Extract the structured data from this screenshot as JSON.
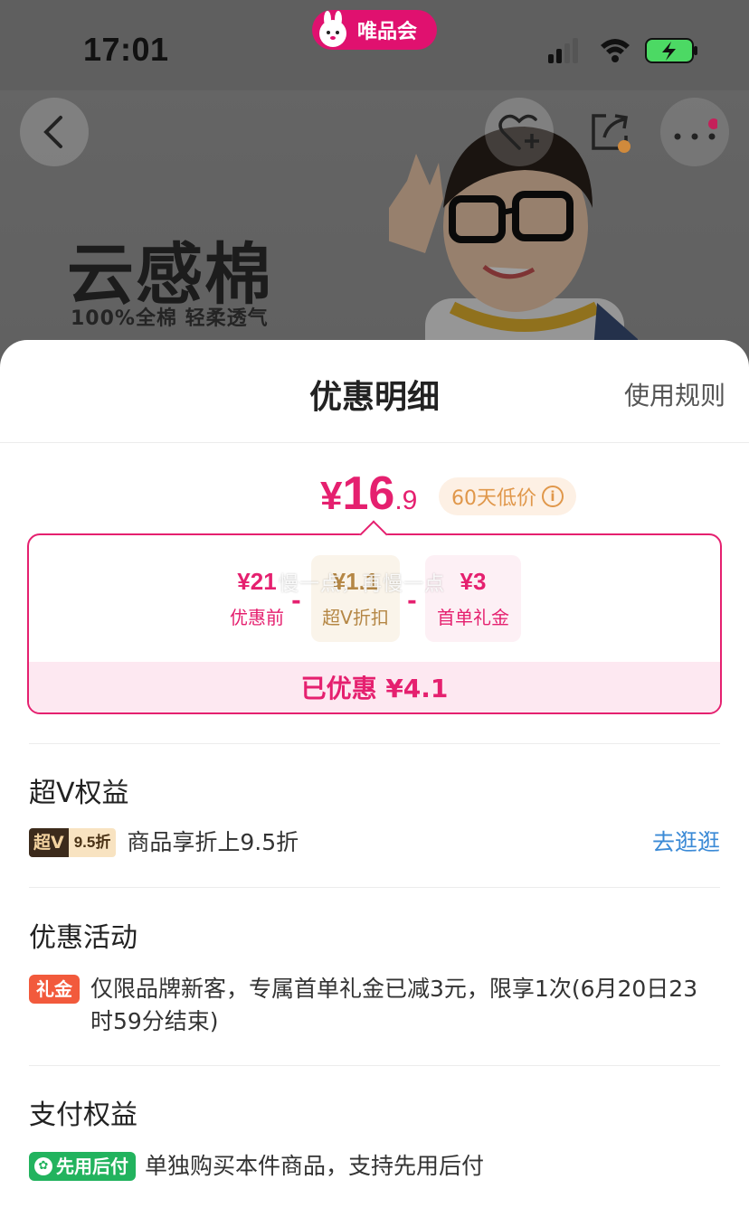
{
  "status_bar": {
    "time": "17:01",
    "app_pill_label": "唯品会"
  },
  "background_page": {
    "promo_title": "云感棉",
    "promo_subtitle": "100%全棉 轻柔透气"
  },
  "sheet": {
    "title": "优惠明细",
    "rules_link": "使用规则",
    "price": {
      "yen": "¥",
      "integer": "16",
      "decimal": ".9"
    },
    "low_price_tag": "60天低价",
    "breakdown": {
      "items": [
        {
          "value": "¥21",
          "label": "优惠前"
        },
        {
          "value": "¥1.1",
          "label": "超V折扣"
        },
        {
          "value": "¥3",
          "label": "首单礼金"
        }
      ],
      "minus": "-",
      "overlay_text": "慢一点，再慢一点",
      "saved": "已优惠 ¥4.1"
    },
    "sections": {
      "svip": {
        "title": "超V权益",
        "badge_left": "超V",
        "badge_right": "9.5折",
        "text": "商品享折上9.5折",
        "link": "去逛逛"
      },
      "promo": {
        "title": "优惠活动",
        "badge": "礼金",
        "text": "仅限品牌新客，专属首单礼金已减3元，限享1次(6月20日23时59分结束)"
      },
      "payment": {
        "title": "支付权益",
        "badge": "先用后付",
        "text": "单独购买本件商品，支持先用后付"
      }
    }
  },
  "colors": {
    "accent": "#e5206f",
    "link": "#3b8ad6",
    "gift": "#f25a3c",
    "pay": "#22b35e",
    "svip_dark": "#3c2b1c",
    "svip_light": "#f8e3c1"
  }
}
